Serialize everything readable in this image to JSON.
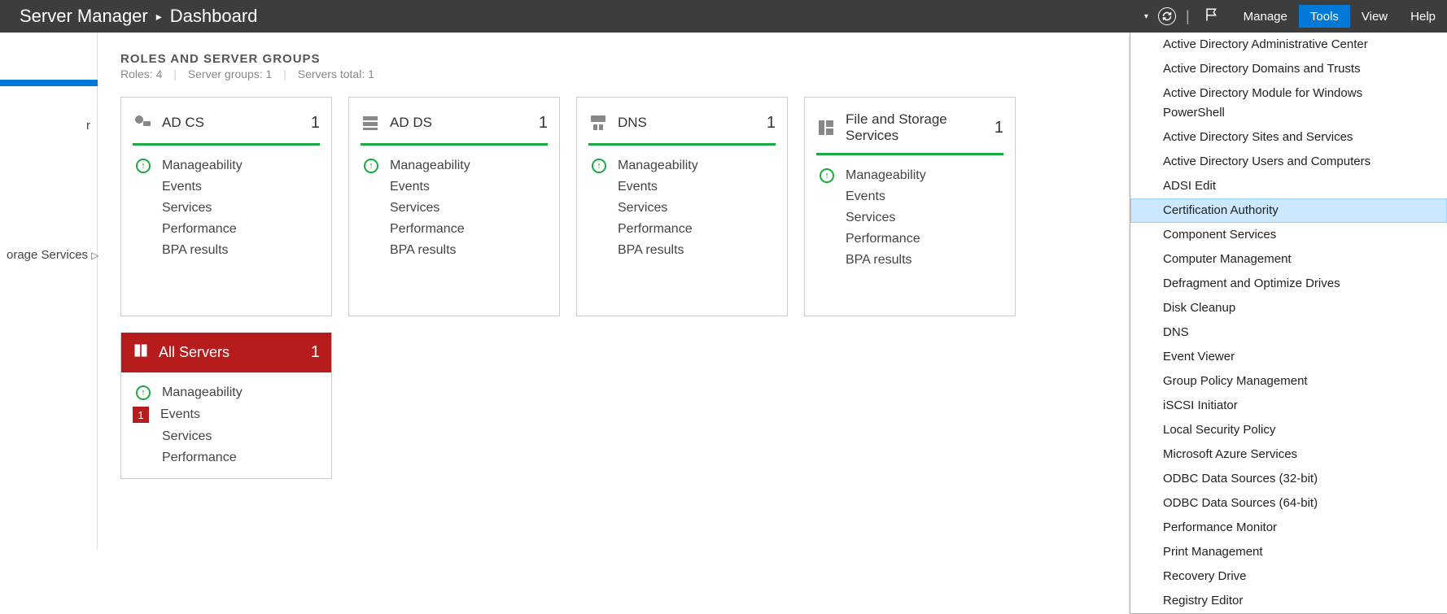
{
  "header": {
    "app_name": "Server Manager",
    "page": "Dashboard",
    "menu": {
      "manage": "Manage",
      "tools": "Tools",
      "view": "View",
      "help": "Help"
    }
  },
  "sidebar": {
    "partial1": "r",
    "partial2_label": "orage Services"
  },
  "section": {
    "title": "ROLES AND SERVER GROUPS",
    "roles_label": "Roles:",
    "roles_count": "4",
    "groups_label": "Server groups:",
    "groups_count": "1",
    "total_label": "Servers total:",
    "total_count": "1"
  },
  "cards": [
    {
      "title": "AD CS",
      "count": "1",
      "tall": false
    },
    {
      "title": "AD DS",
      "count": "1",
      "tall": false
    },
    {
      "title": "DNS",
      "count": "1",
      "tall": false
    },
    {
      "title": "File and Storage Services",
      "count": "1",
      "tall": true
    }
  ],
  "card_rows": {
    "manageability": "Manageability",
    "events": "Events",
    "services": "Services",
    "performance": "Performance",
    "bpa": "BPA results"
  },
  "all_servers": {
    "title": "All Servers",
    "count": "1",
    "alert_count": "1"
  },
  "tools_menu": [
    "Active Directory Administrative Center",
    "Active Directory Domains and Trusts",
    "Active Directory Module for Windows PowerShell",
    "Active Directory Sites and Services",
    "Active Directory Users and Computers",
    "ADSI Edit",
    "Certification Authority",
    "Component Services",
    "Computer Management",
    "Defragment and Optimize Drives",
    "Disk Cleanup",
    "DNS",
    "Event Viewer",
    "Group Policy Management",
    "iSCSI Initiator",
    "Local Security Policy",
    "Microsoft Azure Services",
    "ODBC Data Sources (32-bit)",
    "ODBC Data Sources (64-bit)",
    "Performance Monitor",
    "Print Management",
    "Recovery Drive",
    "Registry Editor"
  ],
  "tools_hover_index": 6
}
